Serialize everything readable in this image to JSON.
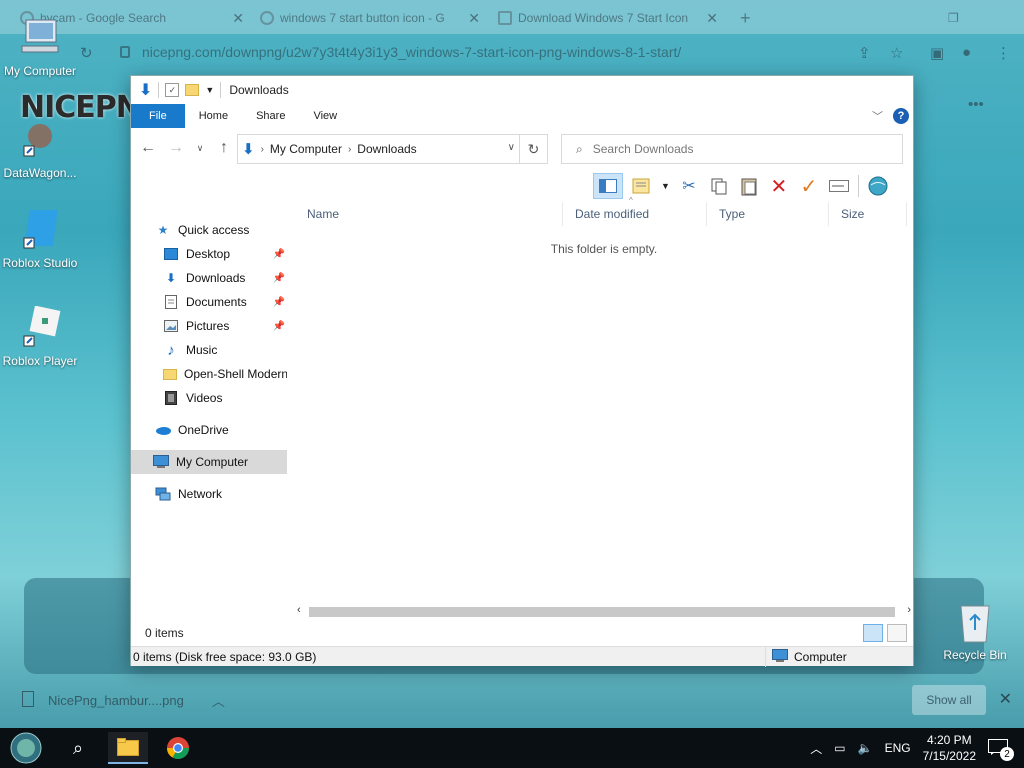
{
  "browser": {
    "tabs": [
      {
        "label": "hycam - Google Search"
      },
      {
        "label": "windows 7 start button icon - G"
      },
      {
        "label": "Download Windows 7 Start Icon"
      }
    ],
    "url": "nicepng.com/downpng/u2w7y3t4t4y3i1y3_windows-7-start-icon-png-windows-8-1-start/",
    "download": {
      "filename": "NicePng_hambur....png",
      "show_all": "Show all"
    }
  },
  "desktop": {
    "logo": "NICEPNG",
    "icons": [
      {
        "label": "My Computer"
      },
      {
        "label": "DataWagon..."
      },
      {
        "label": "Roblox Studio"
      },
      {
        "label": "Roblox Player"
      },
      {
        "label": "Recycle Bin"
      }
    ]
  },
  "explorer": {
    "title": "Downloads",
    "ribbon_tabs": [
      "File",
      "Home",
      "Share",
      "View"
    ],
    "breadcrumb": [
      "My Computer",
      "Downloads"
    ],
    "search_placeholder": "Search Downloads",
    "nav": {
      "quick_access": "Quick access",
      "items": [
        {
          "label": "Desktop",
          "pinned": true
        },
        {
          "label": "Downloads",
          "pinned": true
        },
        {
          "label": "Documents",
          "pinned": true
        },
        {
          "label": "Pictures",
          "pinned": true
        },
        {
          "label": "Music",
          "pinned": false
        },
        {
          "label": "Open-Shell Modern",
          "pinned": false
        },
        {
          "label": "Videos",
          "pinned": false
        }
      ],
      "onedrive": "OneDrive",
      "my_computer": "My Computer",
      "network": "Network"
    },
    "columns": [
      "Name",
      "Date modified",
      "Type",
      "Size"
    ],
    "empty_message": "This folder is empty.",
    "status_items": "0 items",
    "bottom_left": "0 items (Disk free space: 93.0 GB)",
    "bottom_right": "Computer"
  },
  "taskbar": {
    "language": "ENG",
    "time": "4:20 PM",
    "date": "7/15/2022",
    "notifications": "2"
  }
}
